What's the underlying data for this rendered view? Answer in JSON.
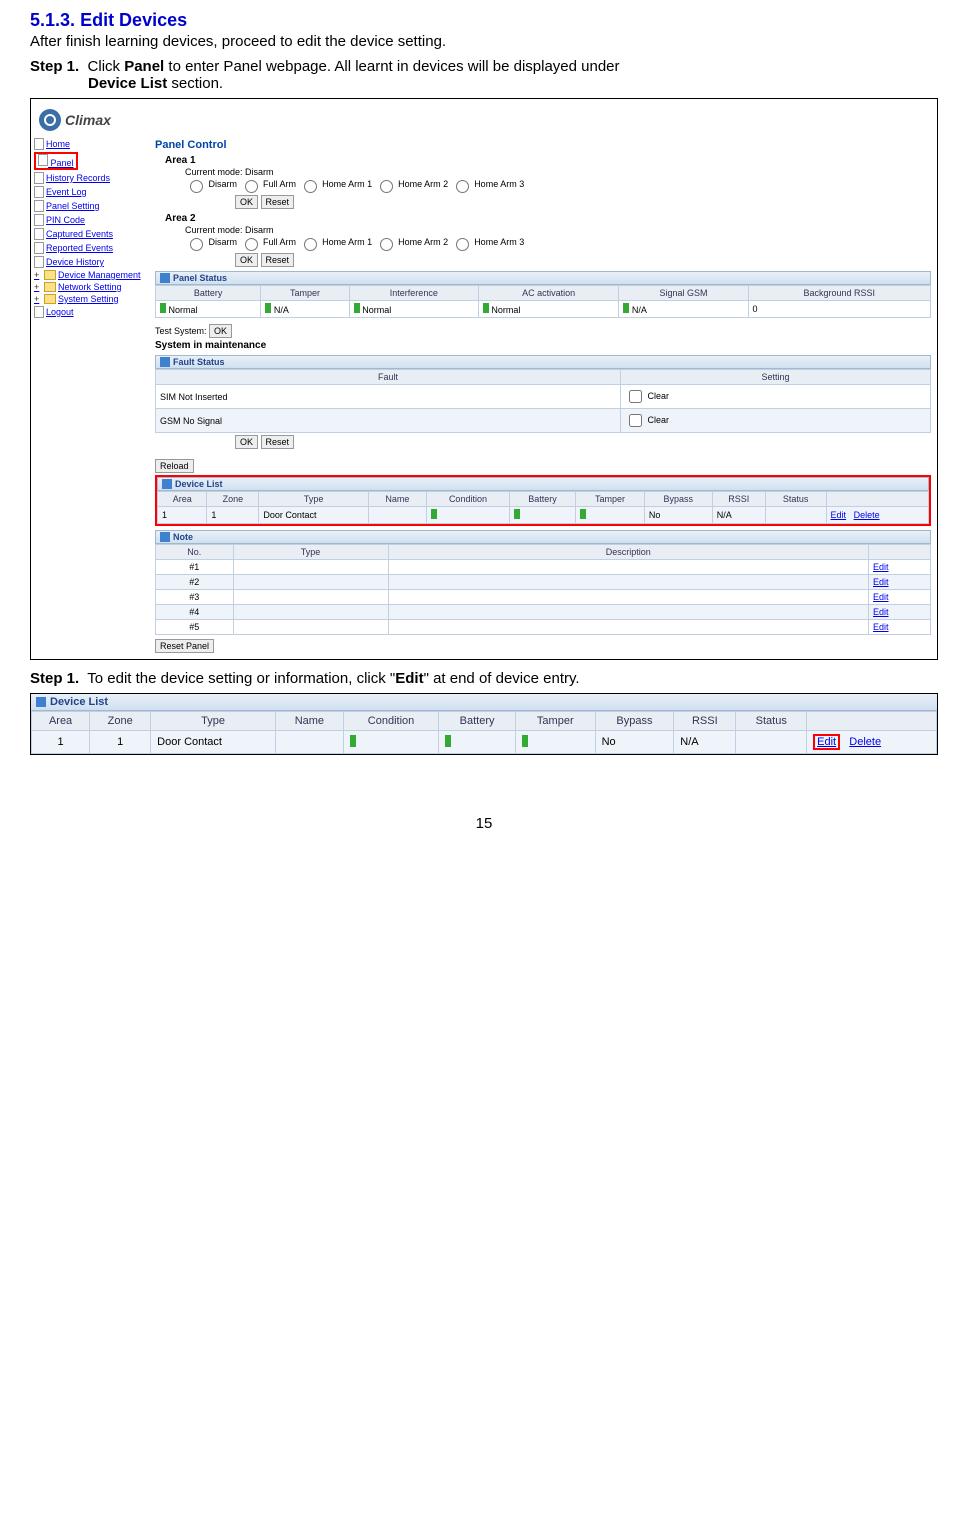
{
  "section": {
    "number": "5.1.3.",
    "title": "Edit Devices",
    "intro": "After finish learning devices, proceed to edit the device setting."
  },
  "step1": {
    "label": "Step 1.",
    "text_before": "Click ",
    "panel_word": "Panel",
    "text_mid": " to enter Panel webpage. All learnt in devices will be displayed under ",
    "device_list_word": "Device List",
    "text_after": " section."
  },
  "step2": {
    "label": "Step 1.",
    "text_before": "To edit the device setting or information, click \"",
    "edit_word": "Edit",
    "text_after": "\" at end of device entry."
  },
  "logo": "Climax",
  "nav": {
    "home": "Home",
    "panel": "Panel",
    "history": "History Records",
    "event_log": "Event Log",
    "panel_setting": "Panel Setting",
    "pin_code": "PIN Code",
    "captured": "Captured Events",
    "reported": "Reported Events",
    "device_history": "Device History",
    "device_mgmt": "Device Management",
    "network": "Network Setting",
    "system": "System Setting",
    "logout": "Logout"
  },
  "panel_control": {
    "title": "Panel Control",
    "area1_title": "Area 1",
    "area2_title": "Area 2",
    "current_mode_label": "Current mode:",
    "current_mode_value": "Disarm",
    "opt_disarm": "Disarm",
    "opt_fullarm": "Full Arm",
    "opt_home1": "Home Arm 1",
    "opt_home2": "Home Arm 2",
    "opt_home3": "Home Arm 3",
    "ok": "OK",
    "reset": "Reset"
  },
  "panel_status": {
    "title": "Panel Status",
    "h_battery": "Battery",
    "h_tamper": "Tamper",
    "h_interference": "Interference",
    "h_ac": "AC activation",
    "h_signal": "Signal GSM",
    "h_rssi": "Background RSSI",
    "v_normal": "Normal",
    "v_na": "N/A",
    "v_zero": "0"
  },
  "test_system": {
    "label": "Test System:",
    "btn": "OK",
    "maint": "System in maintenance"
  },
  "fault_status": {
    "title": "Fault Status",
    "h_fault": "Fault",
    "h_setting": "Setting",
    "r1": "SIM Not Inserted",
    "r2": "GSM No Signal",
    "clear": "Clear",
    "ok": "OK",
    "reset": "Reset"
  },
  "reload": "Reload",
  "device_list": {
    "title": "Device List",
    "h_area": "Area",
    "h_zone": "Zone",
    "h_type": "Type",
    "h_name": "Name",
    "h_condition": "Condition",
    "h_battery": "Battery",
    "h_tamper": "Tamper",
    "h_bypass": "Bypass",
    "h_rssi": "RSSI",
    "h_status": "Status",
    "r_area": "1",
    "r_zone": "1",
    "r_type": "Door Contact",
    "r_bypass": "No",
    "r_rssi": "N/A",
    "edit": "Edit",
    "delete": "Delete"
  },
  "note": {
    "title": "Note",
    "h_no": "No.",
    "h_type": "Type",
    "h_desc": "Description",
    "rows": [
      "#1",
      "#2",
      "#3",
      "#4",
      "#5"
    ],
    "edit": "Edit"
  },
  "reset_panel": "Reset Panel",
  "page_num": "15"
}
